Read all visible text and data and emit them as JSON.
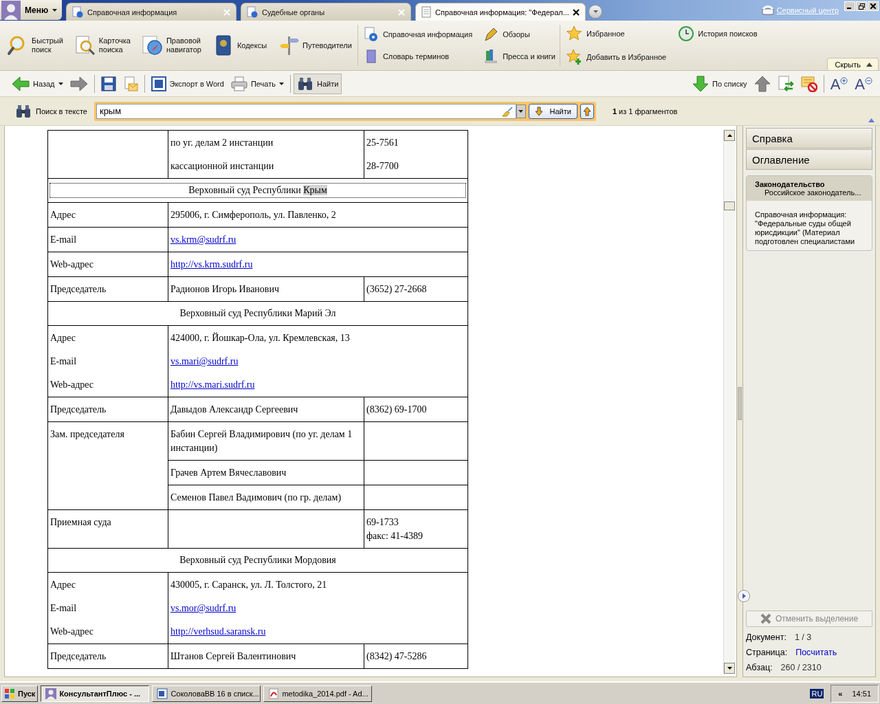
{
  "title_bar": {
    "menu": "Меню",
    "tabs": [
      {
        "label": "Справочная информация",
        "selected": false
      },
      {
        "label": "Судебные органы",
        "selected": false
      },
      {
        "label": "Справочная информация: \"Федерал...",
        "selected": true
      }
    ],
    "service_link": "Сервисный центр"
  },
  "ribbon": {
    "groups": [
      {
        "kind": "large",
        "items": [
          "Быстрый поиск",
          "Карточка поиска",
          "Правовой навигатор",
          "Кодексы",
          "Путеводители"
        ]
      },
      {
        "kind": "small",
        "items": [
          "Справочная информация",
          "Обзоры",
          "Словарь терминов",
          "Пресса и книги"
        ]
      },
      {
        "kind": "small",
        "items": [
          "Избранное",
          "История поисков",
          "Добавить в Избранное"
        ]
      }
    ],
    "hide_button": "Скрыть"
  },
  "toolbar": {
    "left": [
      {
        "kind": "back",
        "label": "Назад",
        "dropdown": true,
        "pressed": false
      },
      {
        "kind": "forward",
        "dropdown": false,
        "pressed": false
      },
      {
        "kind": "separator"
      },
      {
        "kind": "save",
        "dropdown": false,
        "pressed": false
      },
      {
        "kind": "mail",
        "dropdown": false,
        "pressed": false
      },
      {
        "kind": "separator"
      },
      {
        "kind": "word",
        "label": "Экспорт в Word",
        "dropdown": false,
        "pressed": false
      },
      {
        "kind": "print",
        "label": "Печать",
        "dropdown": true,
        "pressed": false
      },
      {
        "kind": "separator"
      },
      {
        "kind": "find",
        "label": "Найти",
        "dropdown": false,
        "pressed": true
      }
    ],
    "right": [
      {
        "kind": "next-in-list",
        "label": "По списку",
        "dropdown": false,
        "pressed": false
      },
      {
        "kind": "prev-in-list",
        "dropdown": false,
        "pressed": false
      },
      {
        "kind": "doc-exchange",
        "dropdown": false,
        "pressed": false
      },
      {
        "kind": "clear-marks",
        "dropdown": false,
        "pressed": false
      },
      {
        "kind": "separator"
      },
      {
        "kind": "font-larger",
        "label": "A",
        "dropdown": false,
        "pressed": false
      },
      {
        "kind": "font-smaller",
        "label": "A",
        "dropdown": false,
        "pressed": false
      }
    ]
  },
  "search_bar": {
    "label": "Поиск в тексте",
    "value": "крым",
    "find_button": "Найти",
    "result": "**1** из 1 фрагментов"
  },
  "document": {
    "rows": [
      {
        "kind": "data",
        "cells": [
          {},
          {
            "lines": [
              {
                "text": "по уг. делам 2 инстанции",
                "link": false
              },
              {
                "text": "кассационной инстанции",
                "link": false
              }
            ]
          },
          {
            "lines": [
              {
                "text": "25-7561",
                "link": false
              },
              {
                "text": "28-7700",
                "link": false
              }
            ]
          }
        ]
      },
      {
        "kind": "title",
        "text": "Верховный суд Республики ",
        "highlight": "Крым",
        "focused": true
      },
      {
        "kind": "data",
        "cells": [
          {
            "lines": [
              {
                "text": "Адрес",
                "link": false
              }
            ]
          },
          {
            "colspan": 2,
            "lines": [
              {
                "text": "295006, г. Симферополь, ул. Павленко, 2",
                "link": false
              }
            ]
          }
        ]
      },
      {
        "kind": "data",
        "cells": [
          {
            "lines": [
              {
                "text": "E-mail",
                "link": false
              }
            ]
          },
          {
            "colspan": 2,
            "lines": [
              {
                "text": "vs.krm@sudrf.ru",
                "link": true
              }
            ]
          }
        ]
      },
      {
        "kind": "data",
        "cells": [
          {
            "lines": [
              {
                "text": "Web-адрес",
                "link": false
              }
            ]
          },
          {
            "colspan": 2,
            "lines": [
              {
                "text": "http://vs.krm.sudrf.ru",
                "link": true
              }
            ]
          }
        ]
      },
      {
        "kind": "data",
        "cells": [
          {
            "lines": [
              {
                "text": "Председатель",
                "link": false
              }
            ]
          },
          {
            "lines": [
              {
                "text": "Радионов Игорь Иванович",
                "link": false
              }
            ]
          },
          {
            "lines": [
              {
                "text": "(3652) 27-2668",
                "link": false
              }
            ]
          }
        ]
      },
      {
        "kind": "title",
        "text": "Верховный суд Республики Марий Эл",
        "focused": false
      },
      {
        "kind": "data",
        "cells": [
          {
            "lines": [
              {
                "text": "Адрес",
                "link": false
              },
              {
                "text": "E-mail",
                "link": false
              },
              {
                "text": "Web-адрес",
                "link": false
              }
            ]
          },
          {
            "colspan": 2,
            "lines": [
              {
                "text": "424000, г. Йошкар-Ола, ул. Кремлевская, 13",
                "link": false
              },
              {
                "text": "vs.mari@sudrf.ru",
                "link": true
              },
              {
                "text": "http://vs.mari.sudrf.ru",
                "link": true
              }
            ]
          }
        ]
      },
      {
        "kind": "data",
        "cells": [
          {
            "lines": [
              {
                "text": "Председатель",
                "link": false
              }
            ]
          },
          {
            "lines": [
              {
                "text": "Давыдов Александр Сергеевич",
                "link": false
              }
            ]
          },
          {
            "lines": [
              {
                "text": "(8362) 69-1700",
                "link": false
              }
            ]
          }
        ]
      },
      {
        "kind": "data",
        "cells": [
          {
            "rowspan": 3,
            "lines": [
              {
                "text": "Зам. председателя",
                "link": false
              }
            ]
          },
          {
            "lines": [
              {
                "text": "Бабин Сергей Владимирович (по уг. делам 1 инстанции)",
                "link": false
              }
            ]
          },
          {}
        ]
      },
      {
        "kind": "data",
        "cells": [
          {
            "lines": [
              {
                "text": "Грачев Артем Вячеславович",
                "link": false
              }
            ]
          },
          {}
        ]
      },
      {
        "kind": "data",
        "cells": [
          {
            "lines": [
              {
                "text": "Семенов Павел Вадимович (по гр. делам)",
                "link": false
              }
            ]
          },
          {}
        ]
      },
      {
        "kind": "data",
        "cells": [
          {
            "lines": [
              {
                "text": "Приемная суда",
                "link": false
              }
            ]
          },
          {},
          {
            "lines": [
              {
                "text": "69-1733",
                "link": false
              },
              {
                "text": "факс: 41-4389",
                "link": false
              }
            ],
            "tight": true
          }
        ]
      },
      {
        "kind": "title",
        "text": "Верховный суд Республики Мордовия",
        "focused": false
      },
      {
        "kind": "data",
        "cells": [
          {
            "lines": [
              {
                "text": "Адрес",
                "link": false
              },
              {
                "text": "E-mail",
                "link": false
              },
              {
                "text": "Web-адрес",
                "link": false
              }
            ]
          },
          {
            "colspan": 2,
            "lines": [
              {
                "text": "430005, г. Саранск, ул. Л. Толстого, 21",
                "link": false
              },
              {
                "text": "vs.mor@sudrf.ru",
                "link": true
              },
              {
                "text": "http://verhsud.saransk.ru",
                "link": true
              }
            ]
          }
        ]
      },
      {
        "kind": "data",
        "cells": [
          {
            "lines": [
              {
                "text": "Председатель",
                "link": false
              }
            ]
          },
          {
            "lines": [
              {
                "text": "Штанов Сергей Валентинович",
                "link": false
              }
            ]
          },
          {
            "lines": [
              {
                "text": "(8342) 47-5286",
                "link": false
              }
            ]
          }
        ]
      }
    ]
  },
  "side_panel": {
    "tabs": [
      "Справка",
      "Оглавление"
    ],
    "card": {
      "title": "Законодательство",
      "subtitle": "Российское законодатель...",
      "text": "Справочная информация: \"Федеральные суды общей юрисдикции\" (Материал подготовлен специалистами"
    },
    "clear_button": {
      "label": "Отменить выделение",
      "disabled": true
    },
    "stats": [
      {
        "label": "Документ:",
        "value": "1 / 3",
        "kind": "text"
      },
      {
        "label": "Страница:",
        "value": "Посчитать",
        "kind": "link"
      },
      {
        "label": "Абзац:",
        "value": "260 / 2310",
        "kind": "text"
      }
    ]
  },
  "taskbar": {
    "start": "Пуск",
    "tasks": [
      {
        "label": "КонсультантПлюс - ...",
        "selected": true
      },
      {
        "label": "СоколоваВВ 16 в списк...",
        "selected": false
      },
      {
        "label": "metodika_2014.pdf - Ad...",
        "selected": false
      }
    ],
    "language": "RU",
    "tray_toggle": "«",
    "clock": "14:51"
  }
}
